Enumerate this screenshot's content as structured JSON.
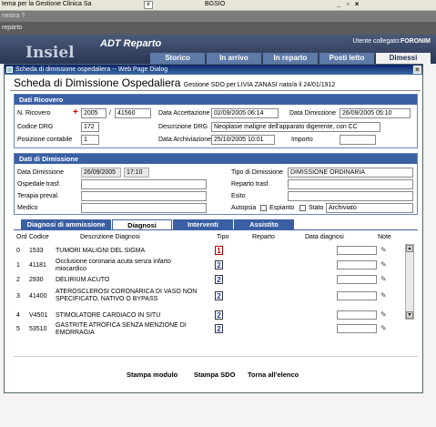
{
  "outer": {
    "title_left": "tema per la Gestione Clinica Sa",
    "title_mid": "BGSIO",
    "controls": "_ &#x25A1; x",
    "menu": "nestra  ?",
    "addr": "reparto"
  },
  "app": {
    "logo": "Insiel",
    "product": "ADT Reparto",
    "user_label": "Utente collegato:",
    "user_name": "FORONIM",
    "tabs": [
      "Storico",
      "In arrivo",
      "In reparto",
      "Posti letto",
      "Dimessi"
    ]
  },
  "dialog": {
    "title": "Scheda di dimissione ospedaliera -- Web Page Dialog",
    "heading": "Scheda di Dimissione Ospedaliera",
    "heading_sub": "Gestione SDO per LIVIA ZANASI nato/a il 24/01/1912"
  },
  "ricovero": {
    "header": "Dati Ricovero",
    "n_ricovero_label": "N. Ricovero",
    "n_ricovero_year": "2005",
    "n_ricovero_num": "41560",
    "data_accettazione_label": "Data Accettazione",
    "data_accettazione": "02/09/2005 06:14",
    "data_dimissione_label": "Data Dimissione",
    "data_dimissione": "26/09/2005 05:10",
    "codice_drg_label": "Codice DRG",
    "codice_drg": "172",
    "descrizione_drg_label": "Descrizione DRG",
    "descrizione_drg": "Neoplasie maligne dell'apparato digerente, con CC",
    "posizione_label": "Posizione contabile",
    "posizione": "1",
    "data_archiviazione_label": "Data Archiviazione",
    "data_archiviazione": "25/10/2005 10:01",
    "importo_label": "Importo",
    "importo": ""
  },
  "dimissione": {
    "header": "Dati di Dimissione",
    "data_label": "Data Dimissione",
    "data": "26/09/2005",
    "ora": "17:10",
    "tipo_label": "Tipo di Dimissione",
    "tipo": "DIMISSIONE ORDINARIA",
    "ospedale_label": "Ospedale trasf.",
    "ospedale": "",
    "reparto_label": "Reparto trasf.",
    "reparto": "",
    "terapia_label": "Terapia preval.",
    "terapia": "",
    "esito_label": "Esito",
    "esito": "",
    "medico_label": "Medico",
    "medico": "",
    "autopsia_label": "Autopsia",
    "espianto_label": "Espianto",
    "stato_label": "Stato",
    "stato": "Archiviato"
  },
  "tabs": [
    "Diagnosi di ammissione",
    "Diagnosi",
    "Interventi",
    "Assistito"
  ],
  "table": {
    "headers": [
      "Ord",
      "Codice",
      "Descrizione Diagnosi",
      "Tipo",
      "Reparto",
      "Data diagnosi",
      "Note"
    ],
    "rows": [
      {
        "ord": "0",
        "codice": "1533",
        "descrizione": "TUMORI MALIGNI DEL SIGMA",
        "tipo": "1"
      },
      {
        "ord": "1",
        "codice": "41181",
        "descrizione": "Occlusione coronaria acuta senza infarto miocardico",
        "tipo": "2"
      },
      {
        "ord": "2",
        "codice": "2930",
        "descrizione": "DELIRIUM ACUTO",
        "tipo": "2"
      },
      {
        "ord": "3",
        "codice": "41400",
        "descrizione": "ATEROSCLEROSI CORONARICA DI VASO NON SPECIFICATO, NATIVO O BYPASS",
        "tipo": "2"
      },
      {
        "ord": "4",
        "codice": "V4501",
        "descrizione": "STIMOLATORE CARDIACO IN SITU",
        "tipo": "2"
      },
      {
        "ord": "5",
        "codice": "53510",
        "descrizione": "GASTRITE ATROFICA SENZA MENZIONE DI EMORRAGIA",
        "tipo": "2"
      }
    ]
  },
  "footer": {
    "stampa_modulo": "Stampa modulo",
    "stampa_sdo": "Stampa SDO",
    "torna": "Torna all'elenco"
  }
}
